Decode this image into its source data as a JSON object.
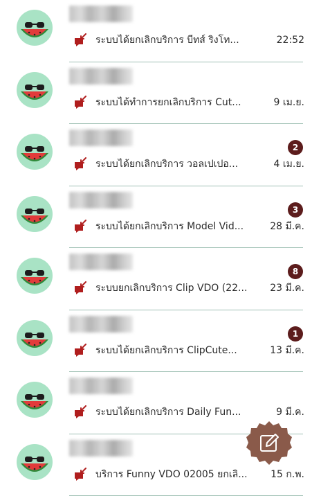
{
  "chats": [
    {
      "preview": "ระบบได้ยกเลิกบริการ บีทส์ ริงโท...",
      "time": "22:52",
      "badge": ""
    },
    {
      "preview": "ระบบได้ทำการยกเลิกบริการ  Cut...",
      "time": "9 เม.ย.",
      "badge": ""
    },
    {
      "preview": "ระบบได้ยกเลิกบริการ วอลเปเปอ...",
      "time": "4 เม.ย.",
      "badge": "2"
    },
    {
      "preview": "ระบบได้ยกเลิกบริการ Model Vid...",
      "time": "28 มี.ค.",
      "badge": "3"
    },
    {
      "preview": "ระบบยกเลิกบริการ Clip VDO (22...",
      "time": "23 มี.ค.",
      "badge": "8"
    },
    {
      "preview": "ระบบได้ยกเลิกบริการ ClipCute...",
      "time": "13 มี.ค.",
      "badge": "1"
    },
    {
      "preview": "ระบบได้ยกเลิกบริการ Daily Fun...",
      "time": "9 มี.ค.",
      "badge": ""
    },
    {
      "preview": "บริการ Funny VDO 02005 ยกเลิ...",
      "time": "15 ก.พ.",
      "badge": ""
    }
  ],
  "icons": {
    "avatar": "watermelon-sunglasses-icon",
    "message": "message-icon",
    "fab": "compose-icon"
  },
  "colors": {
    "avatar_bg": "#a9e3c5",
    "badge": "#5c1c1c",
    "message_icon": "#b01e1e",
    "divider": "#9fc0b3",
    "fab": "#8a5a4a"
  }
}
